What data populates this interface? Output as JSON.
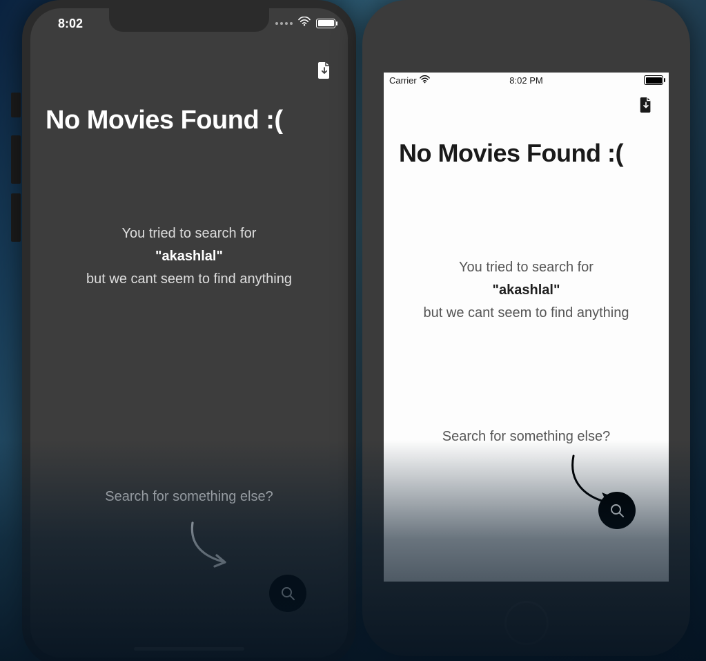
{
  "left": {
    "status": {
      "time": "8:02"
    },
    "title": "No Movies Found :(",
    "msg1": "You tried to search for",
    "query": "\"akashlal\"",
    "msg2": "but we cant seem to find anything",
    "prompt": "Search for something else?"
  },
  "right": {
    "status": {
      "carrier": "Carrier",
      "time": "8:02 PM"
    },
    "title": "No Movies Found :(",
    "msg1": "You tried to search for",
    "query": "\"akashlal\"",
    "msg2": "but we cant seem to find anything",
    "prompt": "Search for something else?"
  }
}
